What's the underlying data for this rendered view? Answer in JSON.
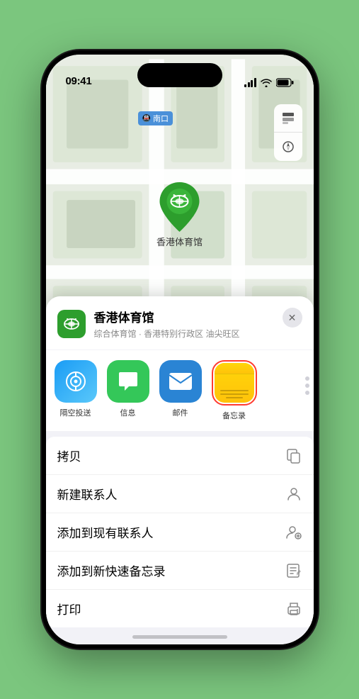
{
  "status_bar": {
    "time": "09:41",
    "location_arrow": "▶"
  },
  "map": {
    "place_label": "南口",
    "marker_label": "香港体育馆"
  },
  "place_info": {
    "name": "香港体育馆",
    "subtitle": "综合体育馆 · 香港特别行政区 油尖旺区",
    "close_label": "✕"
  },
  "share_row": {
    "items": [
      {
        "id": "airdrop",
        "label": "隔空投送"
      },
      {
        "id": "message",
        "label": "信息"
      },
      {
        "id": "mail",
        "label": "邮件"
      },
      {
        "id": "notes",
        "label": "备忘录"
      }
    ]
  },
  "actions": [
    {
      "label": "拷贝",
      "icon": "copy"
    },
    {
      "label": "新建联系人",
      "icon": "person"
    },
    {
      "label": "添加到现有联系人",
      "icon": "person-add"
    },
    {
      "label": "添加到新快速备忘录",
      "icon": "note"
    },
    {
      "label": "打印",
      "icon": "print"
    }
  ]
}
